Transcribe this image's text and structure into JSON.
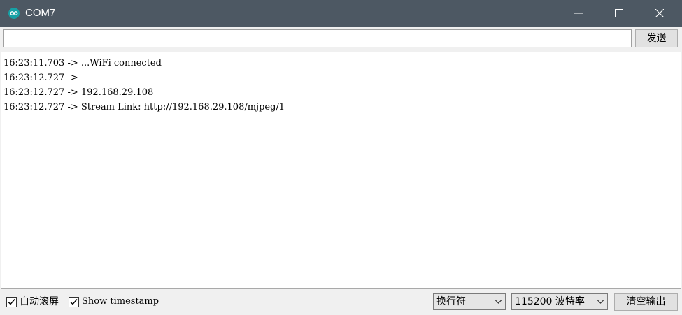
{
  "window": {
    "title": "COM7",
    "icon": "arduino-logo-icon",
    "titlebar_color": "#4d5863",
    "icon_color": "#17a1a5"
  },
  "send": {
    "input_value": "",
    "button_label": "发送"
  },
  "output": {
    "lines": [
      "16:23:11.703 -> ...WiFi connected",
      "16:23:12.727 -> ",
      "16:23:12.727 -> 192.168.29.108",
      "16:23:12.727 -> Stream Link: http://192.168.29.108/mjpeg/1"
    ]
  },
  "bottom": {
    "autoscroll_label": "自动滚屏",
    "autoscroll_checked": true,
    "timestamp_label": "Show timestamp",
    "timestamp_checked": true,
    "line_ending_selected": "换行符",
    "baud_selected": "115200 波特率",
    "clear_label": "清空输出"
  }
}
